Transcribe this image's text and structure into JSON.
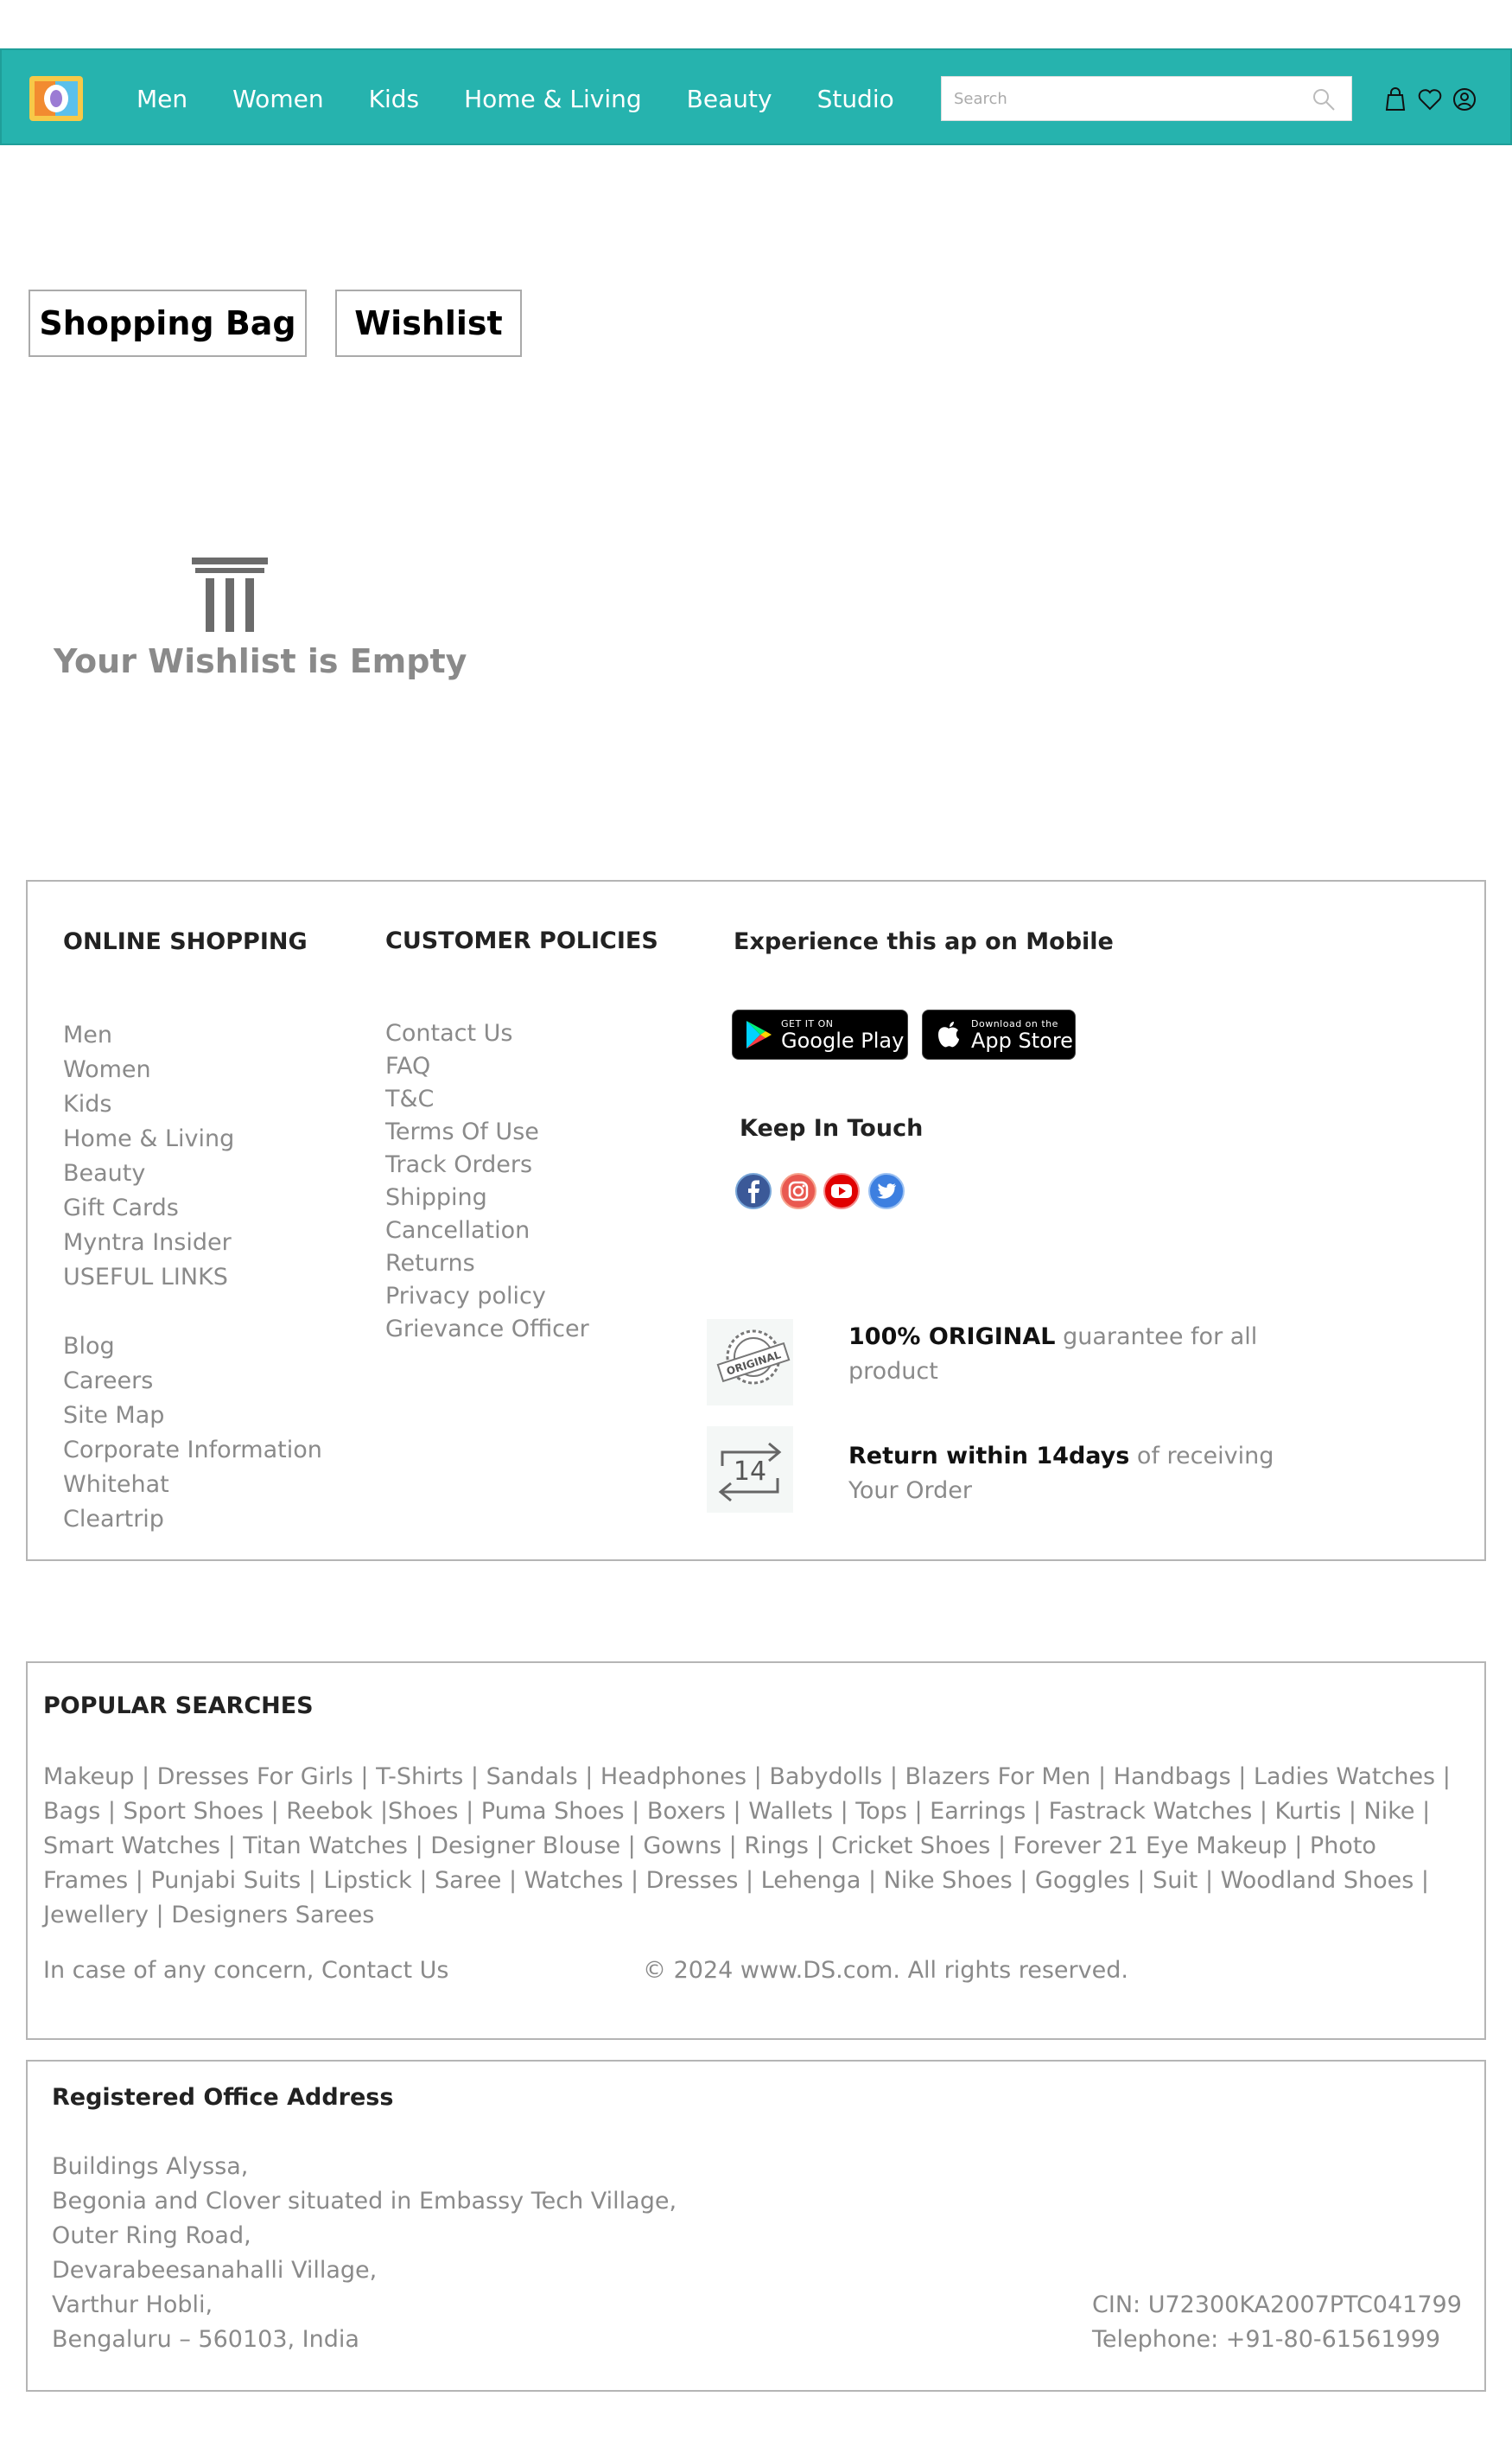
{
  "nav": {
    "links": [
      "Men",
      "Women",
      "Kids",
      "Home & Living",
      "Beauty",
      "Studio"
    ],
    "search_placeholder": "Search",
    "icons": [
      "bag-icon",
      "heart-icon",
      "profile-icon"
    ]
  },
  "tabs": {
    "bag": "Shopping Bag",
    "wishlist": "Wishlist"
  },
  "empty": {
    "icon": "trash-icon",
    "text": "Your Wishlist is Empty"
  },
  "footer": {
    "online_heading": "ONLINE SHOPPING",
    "online_links": [
      "Men",
      "Women",
      "Kids",
      "Home & Living",
      "Beauty",
      "Gift Cards",
      "Myntra Insider",
      "USEFUL LINKS"
    ],
    "useful_links": [
      "Blog",
      "Careers",
      "Site Map",
      "Corporate Information",
      "Whitehat",
      "Cleartrip"
    ],
    "policy_heading": "CUSTOMER POLICIES",
    "policy_links": [
      "Contact Us",
      "FAQ",
      "T&C",
      "Terms Of Use",
      "Track Orders",
      "Shipping",
      "Cancellation",
      "Returns",
      "Privacy policy",
      "Grievance Officer"
    ],
    "mobile_heading": "Experience this ap on Mobile",
    "google_play": {
      "small": "GET IT ON",
      "big": "Google Play"
    },
    "app_store": {
      "small": "Download on the",
      "big": "App Store"
    },
    "keep_heading": "Keep In Touch",
    "social": [
      "facebook-icon",
      "instagram-icon",
      "youtube-icon",
      "twitter-icon"
    ],
    "original": {
      "bold": "100% ORIGINAL",
      "rest": " guarantee for all product",
      "badge": "ORIGINAL"
    },
    "returns": {
      "bold": "Return within 14days",
      "rest": " of receiving Your Order",
      "days": "14"
    }
  },
  "popular": {
    "heading": "POPULAR SEARCHES",
    "text": "Makeup | Dresses For Girls | T-Shirts | Sandals | Headphones | Babydolls | Blazers For Men | Handbags | Ladies Watches | Bags | Sport Shoes | Reebok |Shoes | Puma Shoes | Boxers | Wallets | Tops | Earrings | Fastrack Watches | Kurtis | Nike | Smart Watches | Titan Watches | Designer Blouse | Gowns | Rings | Cricket Shoes | Forever 21  Eye Makeup | Photo Frames | Punjabi Suits | Lipstick | Saree | Watches | Dresses | Lehenga | Nike Shoes | Goggles | Suit | Woodland Shoes | Jewellery | Designers Sarees",
    "concern_prefix": "In case of any concern, ",
    "concern_link": "Contact Us",
    "copyright": "© 2024 www.DS.com. All rights reserved."
  },
  "address": {
    "heading": "Registered Office Address",
    "lines": [
      "Buildings Alyssa,",
      "Begonia and Clover situated in Embassy Tech Village,",
      "Outer Ring Road,",
      "Devarabeesanahalli Village,",
      "Varthur Hobli,",
      "Bengaluru – 560103, India"
    ],
    "cin": "CIN: U72300KA2007PTC041799",
    "telephone": "Telephone: +91-80-61561999"
  }
}
